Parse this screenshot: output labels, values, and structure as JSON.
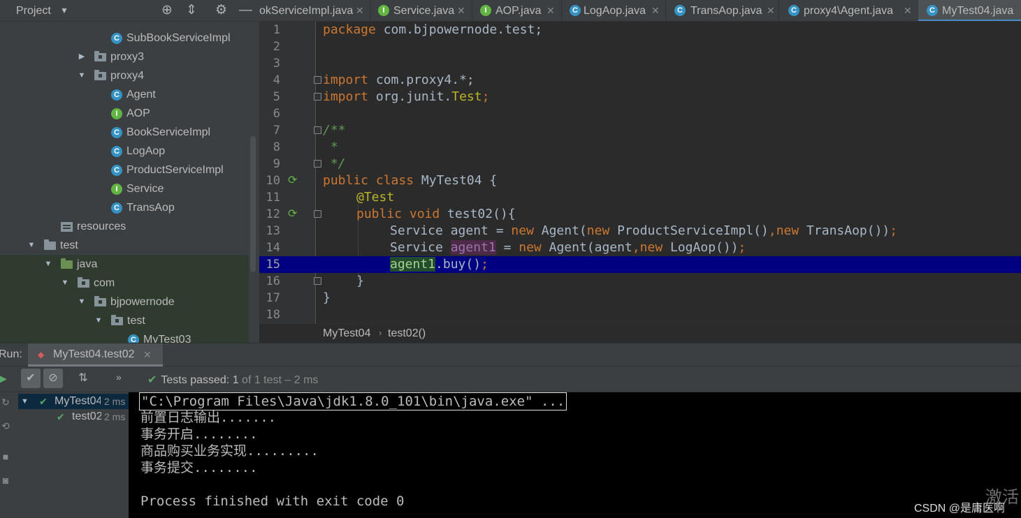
{
  "project": {
    "title": "Project",
    "tree": [
      {
        "label": "SubBookServiceImpl",
        "icon": "class",
        "depth": 6
      },
      {
        "label": "proxy3",
        "icon": "package",
        "depth": 5,
        "arrow": "collapsed"
      },
      {
        "label": "proxy4",
        "icon": "package",
        "depth": 5,
        "arrow": "expanded"
      },
      {
        "label": "Agent",
        "icon": "class",
        "depth": 6
      },
      {
        "label": "AOP",
        "icon": "interface",
        "depth": 6
      },
      {
        "label": "BookServiceImpl",
        "icon": "class",
        "depth": 6
      },
      {
        "label": "LogAop",
        "icon": "class",
        "depth": 6
      },
      {
        "label": "ProductServiceImpl",
        "icon": "class",
        "depth": 6
      },
      {
        "label": "Service",
        "icon": "interface",
        "depth": 6
      },
      {
        "label": "TransAop",
        "icon": "class",
        "depth": 6
      },
      {
        "label": "resources",
        "icon": "resources",
        "depth": 3
      },
      {
        "label": "test",
        "icon": "folder",
        "depth": 2,
        "arrow": "expanded"
      },
      {
        "label": "java",
        "icon": "test-folder",
        "depth": 3,
        "arrow": "expanded"
      },
      {
        "label": "com",
        "icon": "package",
        "depth": 4,
        "arrow": "expanded"
      },
      {
        "label": "bjpowernode",
        "icon": "package",
        "depth": 5,
        "arrow": "expanded"
      },
      {
        "label": "test",
        "icon": "package",
        "depth": 6,
        "arrow": "expanded"
      },
      {
        "label": "MyTest03",
        "icon": "class",
        "depth": 7
      }
    ]
  },
  "tabs": [
    {
      "label": "okServiceImpl.java",
      "icon": "",
      "active": false
    },
    {
      "label": "Service.java",
      "icon": "I",
      "active": false
    },
    {
      "label": "AOP.java",
      "icon": "I",
      "active": false
    },
    {
      "label": "LogAop.java",
      "icon": "C",
      "active": false
    },
    {
      "label": "TransAop.java",
      "icon": "C",
      "active": false
    },
    {
      "label": "proxy4\\Agent.java",
      "icon": "C",
      "active": false
    },
    {
      "label": "MyTest04.java",
      "icon": "C",
      "active": true
    }
  ],
  "editor": {
    "lines": [
      "1",
      "2",
      "3",
      "4",
      "5",
      "6",
      "7",
      "8",
      "9",
      "10",
      "11",
      "12",
      "13",
      "14",
      "15",
      "16",
      "17",
      "18"
    ],
    "code": {
      "l1_kw": "package",
      "l1_rest": " com.bjpowernode.test;",
      "l4_kw": "import",
      "l4_rest": " com.proxy4.*;",
      "l5_kw": "import",
      "l5_rest": " org.junit.",
      "l5_ann": "Test",
      "l5_end": ";",
      "l7": "/**",
      "l8": " *",
      "l9": " */",
      "l10_kw": "public class",
      "l10_rest": " MyTest04 {",
      "l11": "@Test",
      "l12_kw": "public void",
      "l12_rest": " test02(){",
      "l13_a": "Service agent = ",
      "l13_kw1": "new",
      "l13_b": " Agent(",
      "l13_kw2": "new",
      "l13_c": " ProductServiceImpl()",
      "l13_kw3": ",new",
      "l13_d": " TransAop())",
      "l13_e": ";",
      "l14_a": "Service ",
      "l14_hl": "agent1",
      "l14_b": " = ",
      "l14_kw1": "new",
      "l14_c": " Agent(agent",
      "l14_kw2": ",new",
      "l14_d": " LogAop())",
      "l14_e": ";",
      "l15_hl": "agent1",
      "l15_rest": ".buy()",
      "l15_end": ";",
      "l16": "}",
      "l17": "}"
    }
  },
  "breadcrumb": {
    "cls": "MyTest04",
    "method": "test02()"
  },
  "run": {
    "label": "Run:",
    "tab": "MyTest04.test02",
    "status_prefix": "Tests passed: ",
    "status_count": "1",
    "status_rest": " of 1 test",
    "status_time": " – 2 ms",
    "test_tree": [
      {
        "name": "MyTest04",
        "time": "2 ms"
      },
      {
        "name": "test02",
        "time": "2 ms"
      }
    ],
    "console": [
      "\"C:\\Program Files\\Java\\jdk1.8.0_101\\bin\\java.exe\" ...",
      "前置日志输出.......",
      "事务开启........",
      "商品购买业务实现.........",
      "事务提交........",
      "",
      "Process finished with exit code 0"
    ],
    "watermark": "CSDN @是庸医啊",
    "activate": "激活"
  },
  "colors": {
    "accent": "#4a88c7",
    "current_line": "#000080",
    "keyword": "#cc7832",
    "pass_green": "#59a869"
  }
}
